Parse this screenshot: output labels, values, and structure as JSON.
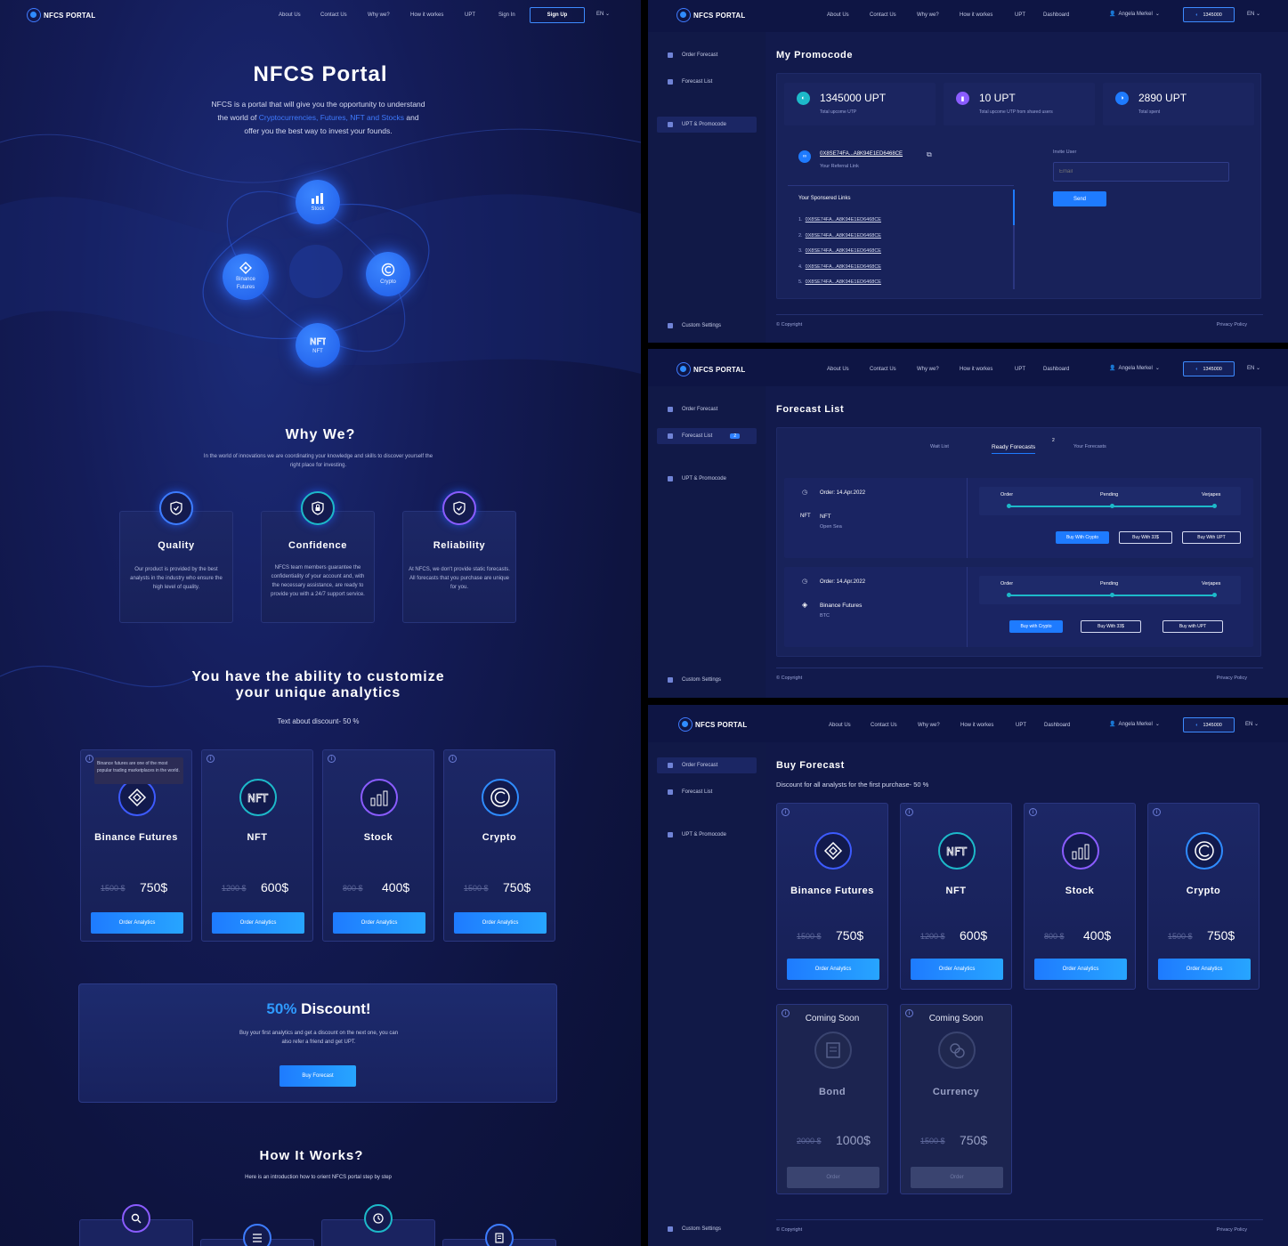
{
  "nav": {
    "logo_text": "NFCS PORTAL",
    "links": [
      "About Us",
      "Contact Us",
      "Why we?",
      "How it workes",
      "UPT",
      "Sign In"
    ],
    "signup": "Sign Up",
    "lang": "EN"
  },
  "hero": {
    "title": "NFCS Portal",
    "line1": "NFCS is a portal that will give you the opportunity to understand",
    "line2_pre": "the world of ",
    "line2_link": "Cryptocurrencies, Futures, NFT and Stocks",
    "line2_post": " and",
    "line3": "offer you the best way to invest your founds.",
    "nodes": {
      "stock": "Stock",
      "binance": "Binance Futures",
      "crypto": "Crypto",
      "nft": "NFT"
    }
  },
  "why": {
    "title": "Why We?",
    "subtitle": "In the world of innovations we are coordinating your knowledge and skills to discover yourself the right place for investing.",
    "cards": [
      {
        "title": "Quality",
        "text": "Our product is provided by the best analysts in the industry who ensure the high level of quality."
      },
      {
        "title": "Confidence",
        "text": "NFCS team members guarantee the confidentiality of your account and, with the necessary assistance, are ready to provide you with a 24/7 support service."
      },
      {
        "title": "Reliability",
        "text": "At NFCS, we don't provide static forecasts. All forecasts that you purchase are unique for you."
      }
    ]
  },
  "custom": {
    "title1": "You have the ability to customize",
    "title2": "your unique analytics",
    "text": "Text about discount- 50 %",
    "tooltip": "Binance futures are one of the most popular trading marketplaces in the world.",
    "products": [
      {
        "name": "Binance Futures",
        "old": "1500 $",
        "new": "750$",
        "btn": "Order Analytics"
      },
      {
        "name": "NFT",
        "old": "1200 $",
        "new": "600$",
        "btn": "Order Analytics"
      },
      {
        "name": "Stock",
        "old": "800 $",
        "new": "400$",
        "btn": "Order Analytics"
      },
      {
        "name": "Crypto",
        "old": "1500 $",
        "new": "750$",
        "btn": "Order Analytics"
      }
    ]
  },
  "discount": {
    "pct": "50%",
    "word": " Discount!",
    "text1": "Buy your first analytics and get a discount on the next one, you can",
    "text2": "also refer a friend and get UPT.",
    "btn": "Buy Forecast"
  },
  "how": {
    "title": "How It Works?",
    "subtitle": "Here is an introduction how to orient NFCS portal step by step"
  },
  "dash_nav": {
    "links": [
      "About Us",
      "Contact Us",
      "Why we?",
      "How it workes",
      "UPT",
      "Dashboard"
    ],
    "user": "Angela Merkel",
    "coins": "1345000",
    "lang": "EN"
  },
  "sidebar": {
    "order": "Order Forecast",
    "list": "Forecast List",
    "upt": "UPT & Promocode",
    "settings": "Custom Settings",
    "list_badge": "2"
  },
  "promo": {
    "title": "My Promocode",
    "stats": [
      {
        "value": "1345000 UPT",
        "label": "Total upcome UTP"
      },
      {
        "value": "10 UPT",
        "label": "Total upcome UTP from shared users"
      },
      {
        "value": "2890 UPT",
        "label": "Total spent"
      }
    ],
    "ref_link": "0X8SE74FA...A8K94E1ED6468CE",
    "ref_label": "Your Referral Link",
    "sponsored_title": "Your Sponsered Links",
    "sponsored": [
      "0X8SE74FA...A8K94E1ED6468CE",
      "0X8SE74FA...A8K94E1ED6468CE",
      "0X8SE74FA...A8K94E1ED6468CE",
      "0X8SE74FA...A8K94E1ED6468CE",
      "0X8SE74FA...A8K94E1ED6468CE"
    ],
    "invite_label": "Invite User",
    "email_ph": "Email",
    "send": "Send"
  },
  "footer": {
    "copyright": "Copyright",
    "privacy": "Privacy Policy"
  },
  "flist": {
    "title": "Forecast List",
    "tabs": [
      "Wait List",
      "Ready Forecasts",
      "Your Forecasts"
    ],
    "tab_count": "2",
    "rows": [
      {
        "order": "Order: 14.Apr.2022",
        "name": "NFT",
        "sub": "Open Sea",
        "s1": "Order",
        "s2": "Pending",
        "s3": "Verjapes",
        "b1": "Buy With Crypto",
        "b2": "Buy With 33$",
        "b3": "Buy With UPT",
        "progress": 1.0
      },
      {
        "order": "Order: 14.Apr.2022",
        "name": "Binance Futures",
        "sub": "BTC",
        "s1": "Order",
        "s2": "Pending",
        "s3": "Verjapes",
        "b1": "Buy with Crypto",
        "b2": "Buy With 33$",
        "b3": "Buy with UPT",
        "progress": 1.0
      }
    ]
  },
  "buy": {
    "title": "Buy Forecast",
    "sub": "Discount for all analysts for the first purchase- 50 %",
    "products": [
      {
        "name": "Binance Futures",
        "old": "1500 $",
        "new": "750$",
        "btn": "Order Analytics"
      },
      {
        "name": "NFT",
        "old": "1200 $",
        "new": "600$",
        "btn": "Order Analytics"
      },
      {
        "name": "Stock",
        "old": "800 $",
        "new": "400$",
        "btn": "Order Analytics"
      },
      {
        "name": "Crypto",
        "old": "1500 $",
        "new": "750$",
        "btn": "Order Analytics"
      }
    ],
    "soon": [
      {
        "badge": "Coming Soon",
        "name": "Bond",
        "old": "2000 $",
        "new": "1000$",
        "btn": "Order"
      },
      {
        "badge": "Coming Soon",
        "name": "Currency",
        "old": "1500 $",
        "new": "750$",
        "btn": "Order"
      }
    ]
  },
  "colors": {
    "accent": "#1e7bff",
    "teal": "#1db9c9",
    "link": "#3f7bff",
    "bg": "#0e1544"
  }
}
